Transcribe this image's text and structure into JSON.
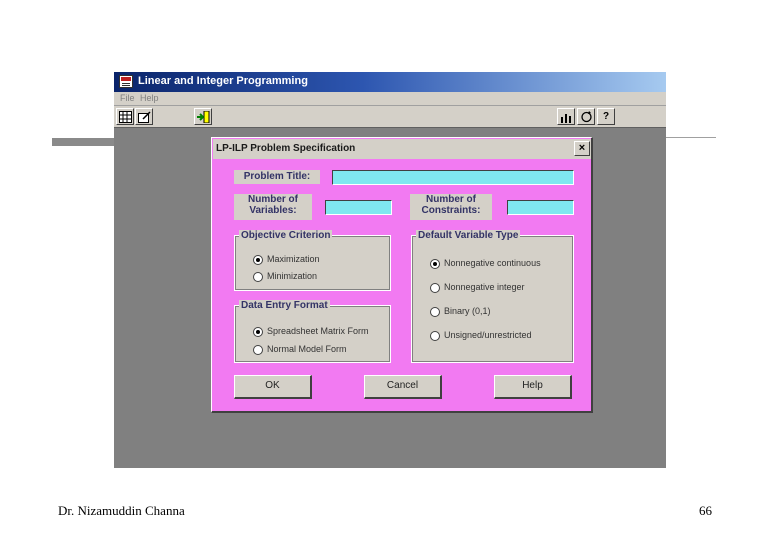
{
  "app": {
    "title": "Linear and Integer Programming",
    "menu": {
      "file": "File",
      "help": "Help"
    },
    "toolbar_help_glyph": "?"
  },
  "dialog": {
    "title": "LP-ILP Problem Specification",
    "close_glyph": "×",
    "problem_title_label": "Problem Title:",
    "problem_title_value": "",
    "num_variables_label": "Number of Variables:",
    "num_variables_value": "",
    "num_constraints_label": "Number of Constraints:",
    "num_constraints_value": "",
    "objective": {
      "legend": "Objective Criterion",
      "options": [
        "Maximization",
        "Minimization"
      ],
      "selected": "Maximization"
    },
    "data_entry": {
      "legend": "Data Entry Format",
      "options": [
        "Spreadsheet Matrix Form",
        "Normal Model Form"
      ],
      "selected": "Spreadsheet Matrix Form"
    },
    "variable_type": {
      "legend": "Default Variable Type",
      "options": [
        "Nonnegative continuous",
        "Nonnegative integer",
        "Binary (0,1)",
        "Unsigned/unrestricted"
      ],
      "selected": "Nonnegative continuous"
    },
    "buttons": {
      "ok": "OK",
      "cancel": "Cancel",
      "help": "Help"
    }
  },
  "footer": {
    "author": "Dr. Nizamuddin Channa",
    "page": "66"
  },
  "colors": {
    "dialog_bg": "#f27af2",
    "field_bg": "#7fe8f0",
    "titlebar": "#0a246a",
    "app_bg": "#808080"
  },
  "icons": [
    "app-logo-icon",
    "grid-icon",
    "edit-icon",
    "run-icon",
    "chart-icon",
    "refresh-icon",
    "help-icon",
    "close-icon"
  ]
}
